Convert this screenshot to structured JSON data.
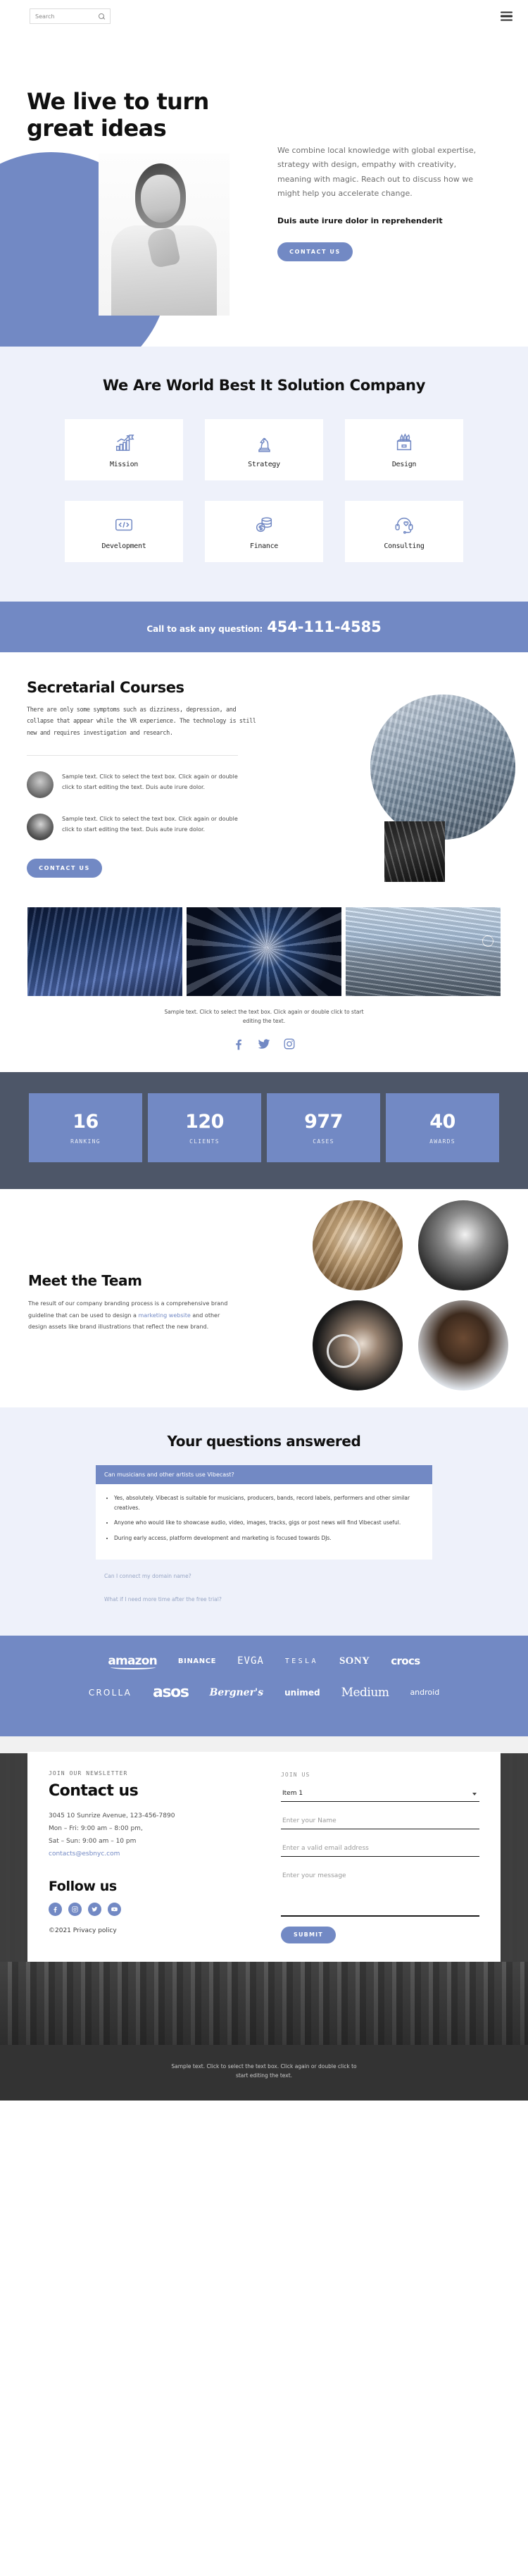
{
  "topbar": {
    "search_placeholder": "Search",
    "search_icon": "search-icon",
    "menu_icon": "hamburger-menu-icon"
  },
  "hero": {
    "heading": "We live to turn great ideas",
    "paragraph": "We combine local knowledge with global expertise, strategy with design, empathy with creativity, meaning with magic. Reach out to discuss how we might help you accelerate change.",
    "subheading": "Duis aute irure dolor in reprehenderit",
    "cta_label": "CONTACT US"
  },
  "services": {
    "title": "We Are World Best It Solution Company",
    "cards": [
      {
        "label": "Mission",
        "icon": "growth-chart-flag-icon"
      },
      {
        "label": "Strategy",
        "icon": "chess-knight-icon"
      },
      {
        "label": "Design",
        "icon": "pencil-holder-icon"
      },
      {
        "label": "Development",
        "icon": "code-brackets-icon"
      },
      {
        "label": "Finance",
        "icon": "coins-dollar-icon"
      },
      {
        "label": "Consulting",
        "icon": "headset-heart-icon"
      }
    ]
  },
  "cta_band": {
    "label": "Call to ask any question:",
    "phone": "454-111-4585"
  },
  "secretarial": {
    "heading": "Secretarial Courses",
    "paragraph": "There are only some symptoms such as dizziness, depression, and collapse that appear while the VR experience. The technology is still new and requires investigation and research.",
    "testimonials": [
      {
        "text": "Sample text. Click to select the text box. Click again or double click to start editing the text. Duis aute irure dolor."
      },
      {
        "text": "Sample text. Click to select the text box. Click again or double click to start editing the text. Duis aute irure dolor."
      }
    ],
    "cta_label": "CONTACT US"
  },
  "gallery": {
    "caption": "Sample text. Click to select the text box. Click again or double click to start editing the text.",
    "socials": [
      "facebook-icon",
      "twitter-icon",
      "instagram-icon"
    ]
  },
  "stats": [
    {
      "number": "16",
      "caption": "RANKING"
    },
    {
      "number": "120",
      "caption": "CLIENTS"
    },
    {
      "number": "977",
      "caption": "CASES"
    },
    {
      "number": "40",
      "caption": "AWARDS"
    }
  ],
  "team": {
    "heading": "Meet the Team",
    "paragraph_before": "The result of our company branding process is a comprehensive brand guideline that can be used to design a ",
    "link_text": "marketing website",
    "paragraph_after": " and other design assets like brand illustrations that reflect the new brand."
  },
  "faq": {
    "title": "Your questions answered",
    "open_question": "Can musicians and other artists use Vibecast?",
    "answers": [
      "Yes, absolutely. Vibecast is suitable for musicians, producers, bands, record labels, performers and other similar creatives.",
      "Anyone who would like to showcase audio, video, images, tracks, gigs or post news will find Vibecast useful.",
      "During early access, platform development and marketing is focused towards DJs."
    ],
    "collapsed": [
      "Can I connect my domain name?",
      "What if I need more time after the free trial?"
    ]
  },
  "brands": {
    "row1": [
      "amazon",
      "BINANCE",
      "EVGA",
      "TESLA",
      "SONY",
      "crocs"
    ],
    "row2": [
      "CROLLA",
      "asos",
      "Bergner's",
      "unimed",
      "Medium",
      "android"
    ]
  },
  "footer": {
    "kicker": "JOIN OUR NEWSLETTER",
    "heading": "Contact us",
    "address_line1": "3045 10 Sunrize Avenue, 123-456-7890",
    "address_line2": "Mon – Fri: 9:00 am – 8:00 pm,",
    "address_line3": "Sat – Sun: 9:00 am – 10 pm",
    "email": "contacts@esbnyc.com",
    "follow_heading": "Follow us",
    "socials": [
      "facebook-icon",
      "instagram-icon",
      "twitter-icon",
      "youtube-icon"
    ],
    "copyright": "©2021 Privacy policy",
    "form": {
      "join_label": "JOIN US",
      "select_value": "Item 1",
      "name_placeholder": "Enter your Name",
      "email_placeholder": "Enter a valid email address",
      "message_placeholder": "Enter your message",
      "submit_label": "SUBMIT"
    }
  },
  "bottom_bar": {
    "text": "Sample text. Click to select the text box. Click again or double click to start editing the text."
  },
  "colors": {
    "accent": "#7289c4",
    "light_bg": "#eef1fa",
    "dark_band": "#4d5668",
    "bottom_bar": "#333333"
  }
}
